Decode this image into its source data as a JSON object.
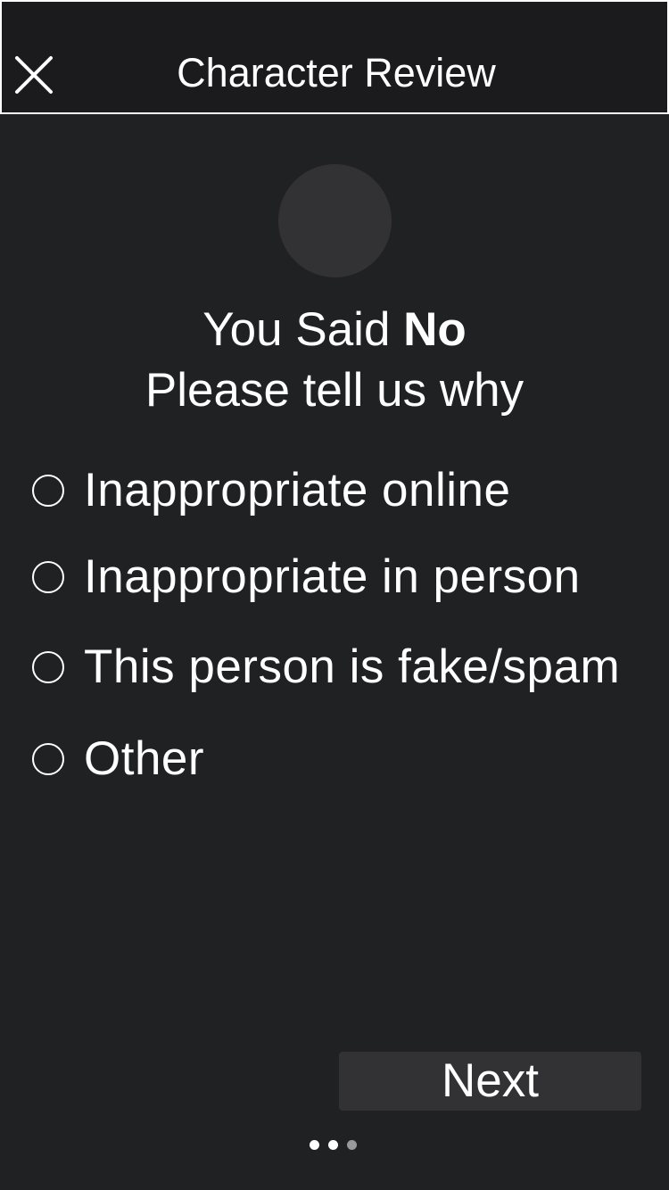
{
  "header": {
    "title": "Character Review",
    "close_icon": "close-icon"
  },
  "review": {
    "heading_prefix": "You Said ",
    "heading_answer": "No",
    "subheading": "Please tell us why"
  },
  "options": [
    {
      "label": "Inappropriate online",
      "selected": false
    },
    {
      "label": "Inappropriate in person",
      "selected": false
    },
    {
      "label": "This person is fake/spam",
      "selected": false
    },
    {
      "label": "Other",
      "selected": false
    }
  ],
  "footer": {
    "next_label": "Next",
    "pager": {
      "total": 3,
      "active": [
        1,
        2
      ]
    }
  },
  "colors": {
    "background": "#202123",
    "header_background": "#1b1b1d",
    "avatar": "#323234",
    "button": "#323234",
    "text": "#ffffff"
  }
}
